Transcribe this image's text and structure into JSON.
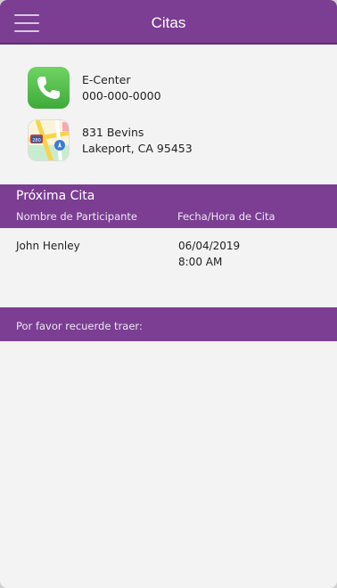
{
  "header": {
    "title": "Citas"
  },
  "contact": {
    "name": "E-Center",
    "phone": "000-000-0000",
    "address_line1": "831 Bevins",
    "address_line2": "Lakeport, CA 95453"
  },
  "icons": {
    "menu": "hamburger-menu-icon",
    "phone": "phone-icon",
    "maps": "maps-icon"
  },
  "next_appointment": {
    "title": "Próxima Cita",
    "col_participant": "Nombre de Participante",
    "col_datetime": "Fecha/Hora de Cita",
    "rows": [
      {
        "participant": "John Henley",
        "date": "06/04/2019",
        "time": "8:00 AM"
      }
    ]
  },
  "reminder": {
    "label": "Por favor recuerde traer:"
  },
  "colors": {
    "brand": "#7b3e93",
    "background": "#f3f3f3",
    "phone_green": "#4cbf45"
  }
}
